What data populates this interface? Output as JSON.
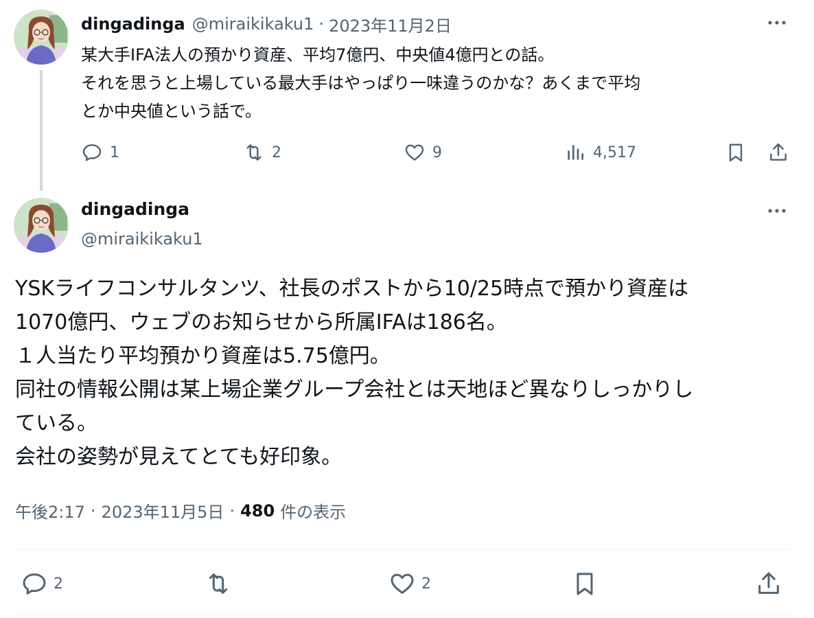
{
  "tweet1": {
    "display_name": "dingadinga",
    "handle": "@miraikikaku1",
    "separator": "·",
    "date": "2023年11月2日",
    "text_lines": [
      "某大手IFA法人の預かり資産、平均7億円、中央値4億円との話。",
      "それを思うと上場している最大手はやっぱり一味違うのかな？あくまで平均",
      "とか中央値という話で。"
    ],
    "actions": {
      "replies": "1",
      "reposts": "2",
      "likes": "9",
      "views": "4,517"
    }
  },
  "tweet2": {
    "display_name": "dingadinga",
    "handle": "@miraikikaku1",
    "text_lines": [
      "YSKライフコンサルタンツ、社長のポストから10/25時点で預かり資産は",
      "1070億円、ウェブのお知らせから所属IFAは186名。",
      "１人当たり平均預かり資産は5.75億円。",
      "同社の情報公開は某上場企業グループ会社とは天地ほど異なりしっかりし",
      "ている。",
      "会社の姿勢が見えてとても好印象。"
    ],
    "time": "午後2:17",
    "separator": "·",
    "date": "2023年11月5日",
    "views_count": "480",
    "views_label": "件の表示",
    "actions": {
      "replies": "2",
      "likes": "2"
    }
  },
  "icons": {
    "reply": "reply-icon",
    "repost": "repost-icon",
    "like": "like-icon",
    "views": "views-icon",
    "bookmark": "bookmark-icon",
    "share": "share-icon",
    "more": "more-icon"
  },
  "colors": {
    "text": "#0f1419",
    "muted": "#536471",
    "thread_line": "#cfd9de",
    "divider": "#eff3f4"
  }
}
